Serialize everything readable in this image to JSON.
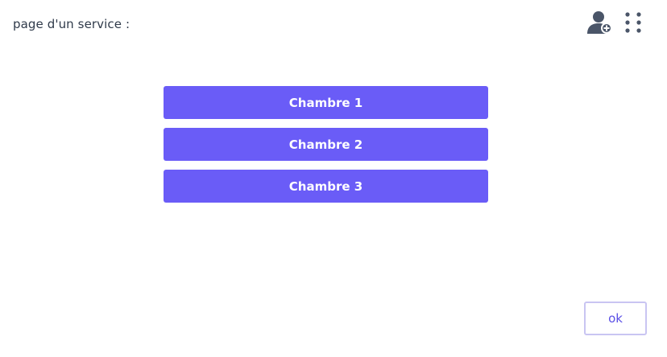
{
  "header": {
    "title": "page d'un service :",
    "icons": [
      "add-user-icon",
      "grid-menu-icon"
    ]
  },
  "rooms": [
    {
      "label": "Chambre 1"
    },
    {
      "label": "Chambre 2"
    },
    {
      "label": "Chambre 3"
    }
  ],
  "footer": {
    "ok_label": "ok"
  },
  "colors": {
    "primary": "#6a5cf7",
    "text": "#2f3a4a",
    "icon": "#4a5568",
    "ok_border": "#c9c5f2",
    "ok_text": "#5a4fe6"
  }
}
